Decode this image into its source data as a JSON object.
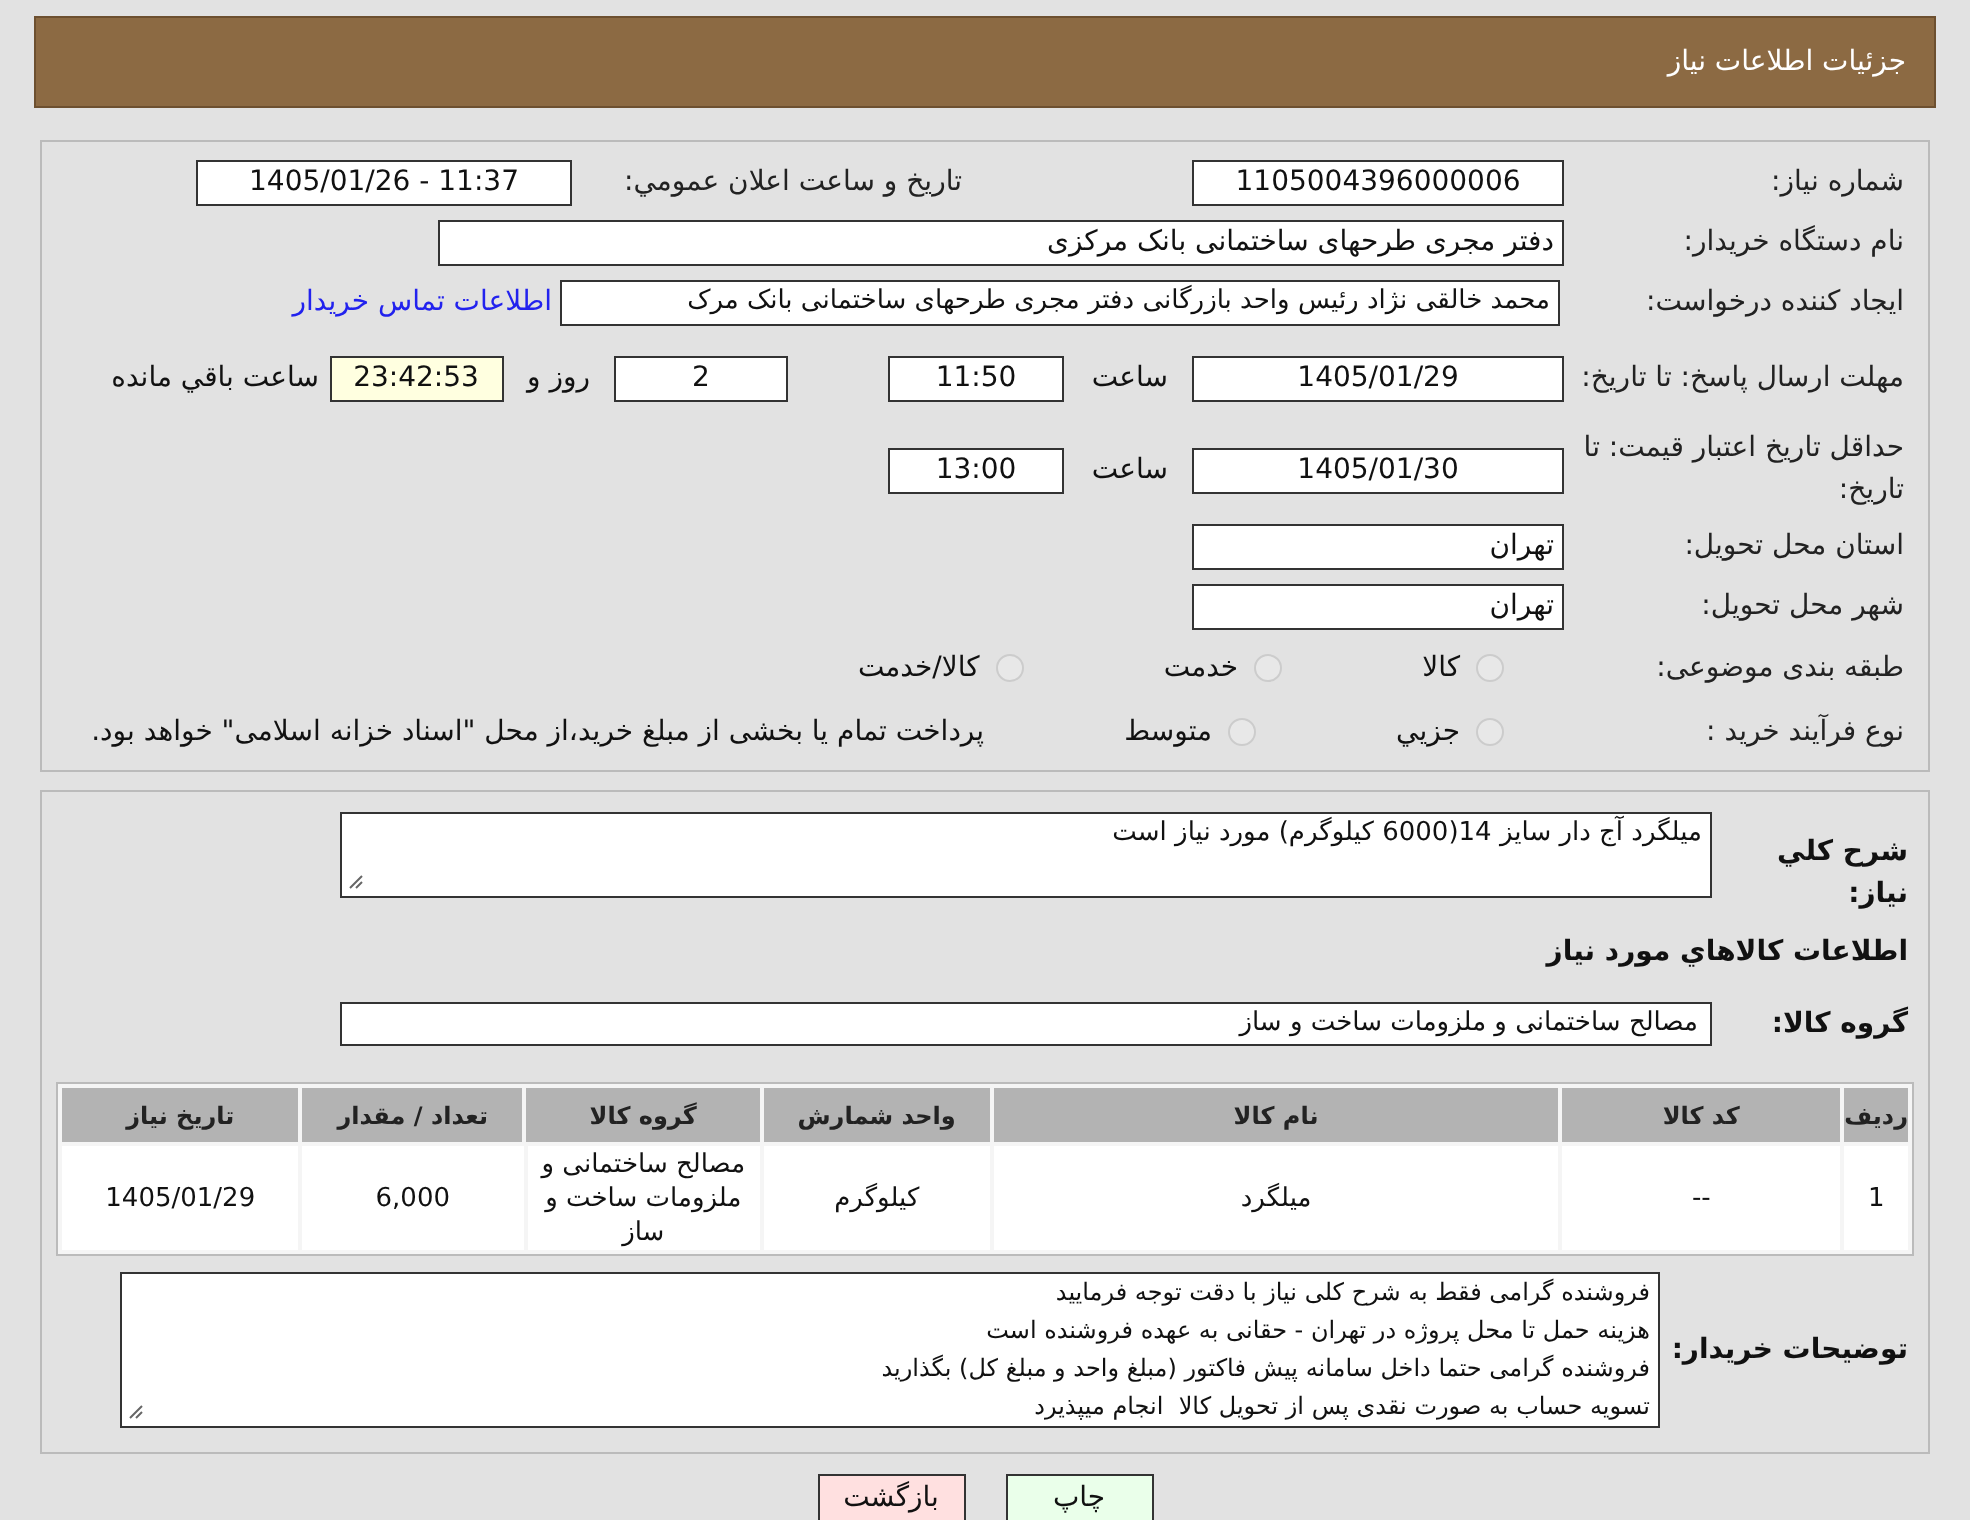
{
  "header": {
    "title": "جزئیات اطلاعات نیاز"
  },
  "need_number": {
    "label": "شماره نیاز:",
    "value": "1105004396000006"
  },
  "announce": {
    "label": "تاريخ و ساعت اعلان عمومي:",
    "value": "1405/01/26 - 11:37"
  },
  "buyer_org": {
    "label": "نام دستگاه خریدار:",
    "value": "دفتر مجری طرحهای ساختمانی بانک مرکزی"
  },
  "requester": {
    "label": "ایجاد کننده درخواست:",
    "value": "محمد خالقی نژاد رئیس واحد بازرگانی دفتر مجری طرحهای ساختمانی بانک مرک",
    "link": "اطلاعات تماس خریدار"
  },
  "deadline": {
    "label": "مهلت ارسال پاسخ: تا تاریخ:",
    "date": "1405/01/29",
    "time_label": "ساعت",
    "time": "11:50",
    "days": "2",
    "days_label": "روز و",
    "remaining": "23:42:53",
    "remaining_label": "ساعت باقي مانده"
  },
  "validity": {
    "label": "حداقل تاریخ اعتبار قیمت: تا تاریخ:",
    "date": "1405/01/30",
    "time_label": "ساعت",
    "time": "13:00"
  },
  "province": {
    "label": "استان محل تحویل:",
    "value": "تهران"
  },
  "city": {
    "label": "شهر محل تحویل:",
    "value": "تهران"
  },
  "category": {
    "label": "طبقه بندی موضوعی:",
    "options": [
      {
        "label": "کالا",
        "selected": false
      },
      {
        "label": "خدمت",
        "selected": false
      },
      {
        "label": "کالا/خدمت",
        "selected": false
      }
    ]
  },
  "purchase_type": {
    "label": "نوع فرآیند خرید :",
    "options": [
      {
        "label": "جزيي",
        "selected": false
      },
      {
        "label": "متوسط",
        "selected": false
      }
    ],
    "note": "پرداخت تمام یا بخشی از مبلغ خرید،از محل \"اسناد خزانه اسلامی\" خواهد بود."
  },
  "description": {
    "label": "شرح کلي نياز:",
    "value": "میلگرد آج دار سایز 14(6000 کیلوگرم) مورد نیاز است"
  },
  "goods_title": "اطلاعات کالاهاي مورد نياز",
  "goods_group": {
    "label": "گروه کالا:",
    "value": "مصالح ساختمانی و ملزومات ساخت و ساز"
  },
  "table": {
    "columns": [
      "ردیف",
      "کد کالا",
      "نام کالا",
      "واحد شمارش",
      "گروه کالا",
      "تعداد / مقدار",
      "تاریخ نیاز"
    ],
    "rows": [
      [
        "1",
        "--",
        "میلگرد",
        "کیلوگرم",
        "مصالح ساختمانی و ملزومات ساخت و ساز",
        "6,000",
        "1405/01/29"
      ]
    ]
  },
  "buyer_notes": {
    "label": "توضیحات خریدار:",
    "lines": [
      "فروشنده گرامی فقط به شرح کلی نیاز با دقت توجه فرمایید",
      "هزینه حمل تا محل پروژه در تهران - حقانی به عهده فروشنده است",
      "فروشنده گرامی حتما داخل سامانه پیش فاکتور (مبلغ واحد و مبلغ کل) بگذارید",
      "تسویه حساب به صورت نقدی پس از تحویل کالا  انجام میپذیرد"
    ]
  },
  "buttons": [
    {
      "label": "چاپ",
      "kind": "print"
    },
    {
      "label": "بازگشت",
      "kind": "back"
    }
  ]
}
